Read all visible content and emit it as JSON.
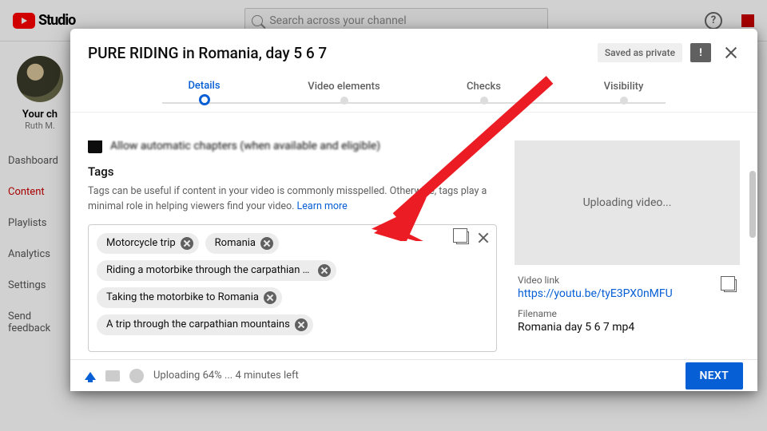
{
  "bg": {
    "brand": "Studio",
    "search_placeholder": "Search across your channel",
    "channel_label": "Your ch",
    "channel_owner": "Ruth M.",
    "menu": [
      "Dashboard",
      "Content",
      "Playlists",
      "Analytics",
      "Settings",
      "Send feedback"
    ]
  },
  "modal": {
    "title": "PURE RIDING in Romania, day 5 6 7",
    "saved_label": "Saved as private",
    "steps": [
      "Details",
      "Video elements",
      "Checks",
      "Visibility"
    ],
    "chapters_label": "Allow automatic chapters (when available and eligible)",
    "tags": {
      "title": "Tags",
      "description": "Tags can be useful if content in your video is commonly misspelled. Otherwise, tags play a minimal role in helping viewers find your video.",
      "learn_more": "Learn more",
      "items": [
        "Motorcycle trip",
        "Romania",
        "Riding a motorbike through the carpathian moun...",
        "Taking the motorbike to Romania",
        "A trip through the carpathian mountains"
      ]
    },
    "preview": {
      "status": "Uploading video...",
      "link_label": "Video link",
      "link": "https://youtu.be/tyE3PX0nMFU",
      "filename_label": "Filename",
      "filename": "Romania day 5 6 7 mp4"
    },
    "footer": {
      "status": "Uploading 64% ... 4 minutes left",
      "next": "NEXT"
    }
  }
}
